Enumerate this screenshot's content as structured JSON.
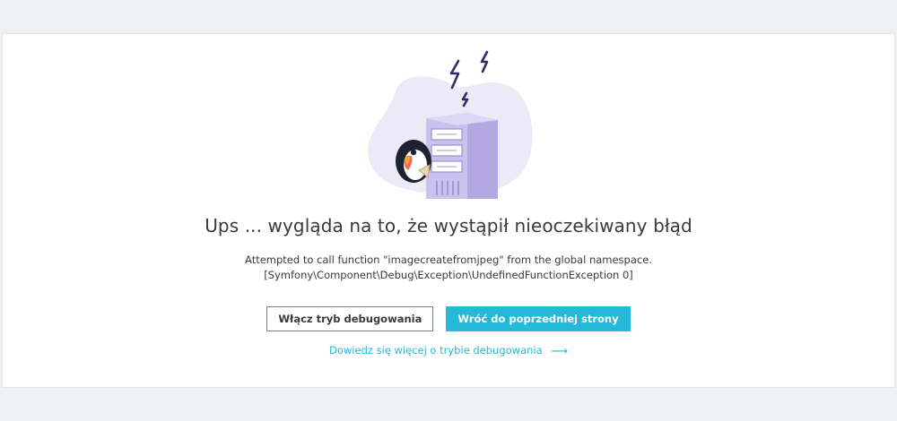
{
  "error_page": {
    "title": "Ups ... wygląda na to, że wystąpił nieoczekiwany błąd",
    "message_line1": "Attempted to call function \"imagecreatefromjpeg\" from the global namespace.",
    "message_line2": "[Symfony\\Component\\Debug\\Exception\\UndefinedFunctionException 0]",
    "enable_debug_label": "Włącz tryb debugowania",
    "back_label": "Wróć do poprzedniej strony",
    "learn_more_label": "Dowiedz się więcej o trybie debugowania",
    "learn_more_arrow": "⟶"
  },
  "icons": {
    "illustration": "server-error-illustration",
    "mascot": "puffin-mascot-icon",
    "lightning": "lightning-bolt-icon",
    "arrow": "arrow-right-icon"
  },
  "colors": {
    "page_background": "#eef0f2",
    "card_background": "#ffffff",
    "text": "#363a41",
    "accent": "#25b9d7",
    "blob": "#eceaf6",
    "server": "#bdb4e6",
    "server_dark": "#9d92d6",
    "bolt": "#2f2e6b"
  }
}
